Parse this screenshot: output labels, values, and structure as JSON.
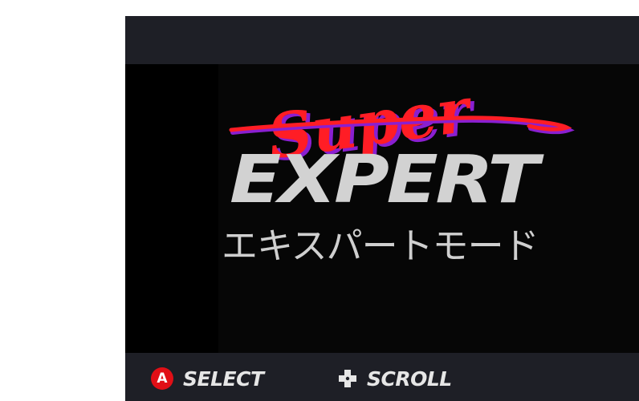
{
  "logo": {
    "script_word": "Super",
    "main_word": "EXPERT",
    "japanese": "エキスパートモード"
  },
  "controls": {
    "select": {
      "button_glyph": "A",
      "label": "SELECT",
      "button_color": "#e10f16"
    },
    "scroll": {
      "icon": "dpad-icon",
      "label": "SCROLL"
    }
  },
  "colors": {
    "bar_background": "#1e1f26",
    "screen_background": "#060606",
    "script_red": "#ff1d25",
    "script_purple": "#8a1fd0",
    "expert_gray": "#d2d2d2"
  }
}
